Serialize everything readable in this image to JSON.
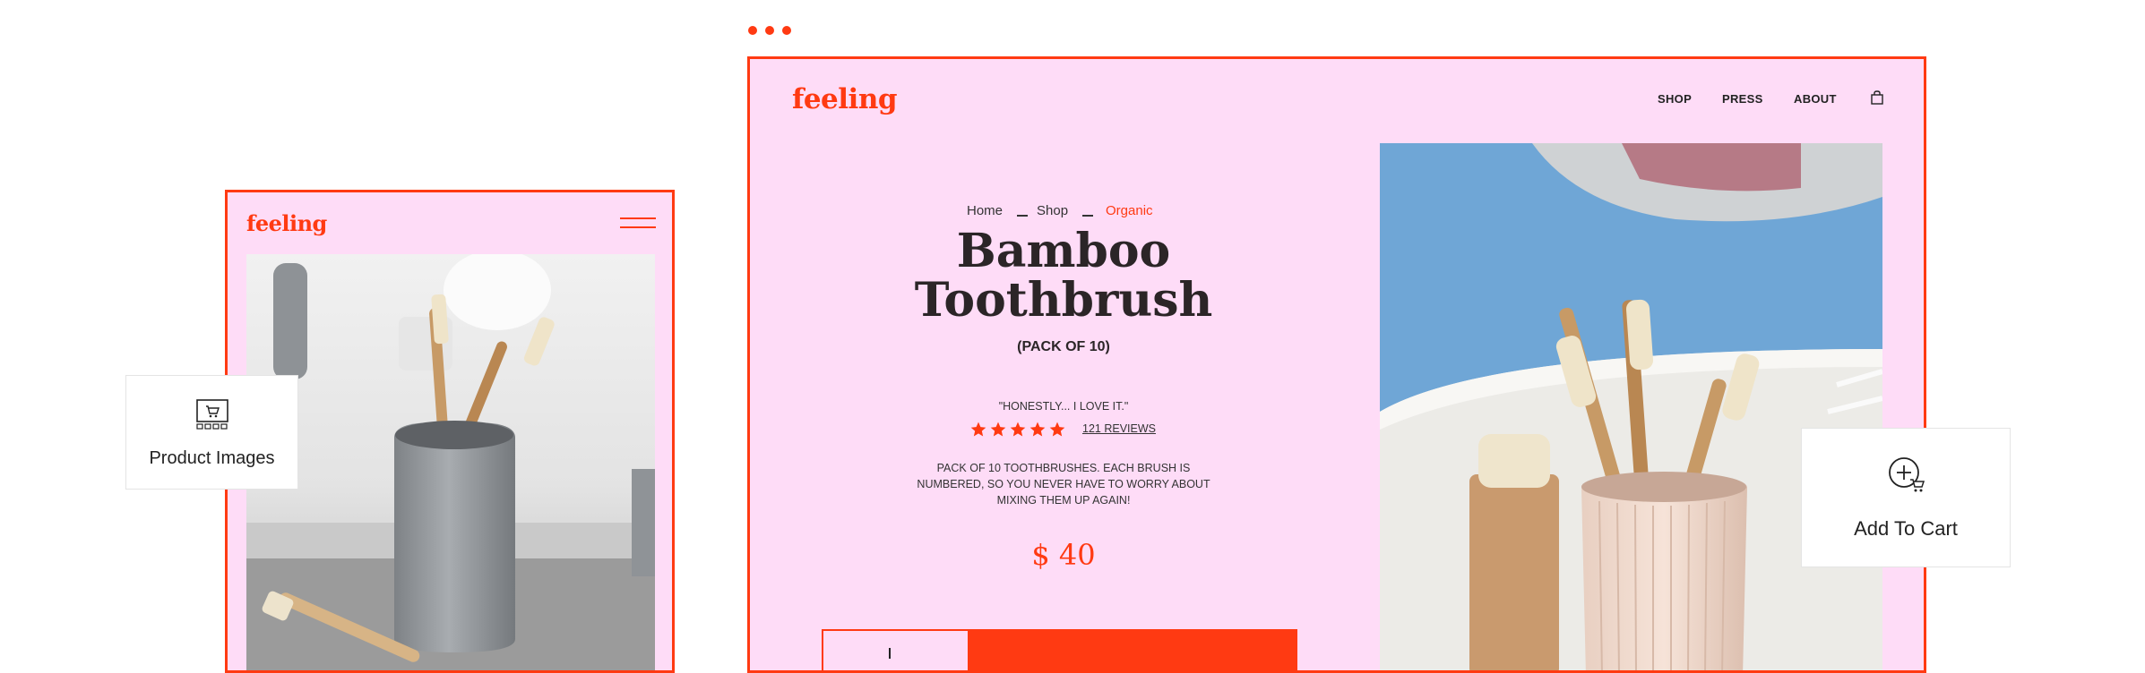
{
  "brand": {
    "logo": "feeling",
    "accent_color": "#ff3a12",
    "background_color": "#fedcf7"
  },
  "nav": {
    "shop": "SHOP",
    "press": "PRESS",
    "about": "ABOUT",
    "cart_icon": "bag-icon"
  },
  "breadcrumb": {
    "home": "Home",
    "shop": "Shop",
    "current": "Organic"
  },
  "product": {
    "title_line1": "Bamboo",
    "title_line2": "Toothbrush",
    "subtitle": "(PACK OF 10)",
    "quote": "\"HONESTLY... I LOVE IT.\"",
    "rating_stars": 5,
    "reviews": "121 REVIEWS",
    "description_line1": "PACK OF 10 TOOTHBRUSHES. EACH BRUSH IS",
    "description_line2": "NUMBERED, SO YOU NEVER HAVE TO WORRY ABOUT",
    "description_line3": "MIXING THEM UP AGAIN!",
    "price": "$ 40"
  },
  "mobile": {
    "logo": "feeling",
    "menu_icon": "hamburger-icon"
  },
  "cards": {
    "product_images": {
      "label": "Product Images",
      "icon": "product-gallery-icon"
    },
    "add_to_cart": {
      "label": "Add To Cart",
      "icon": "add-to-cart-icon"
    }
  }
}
